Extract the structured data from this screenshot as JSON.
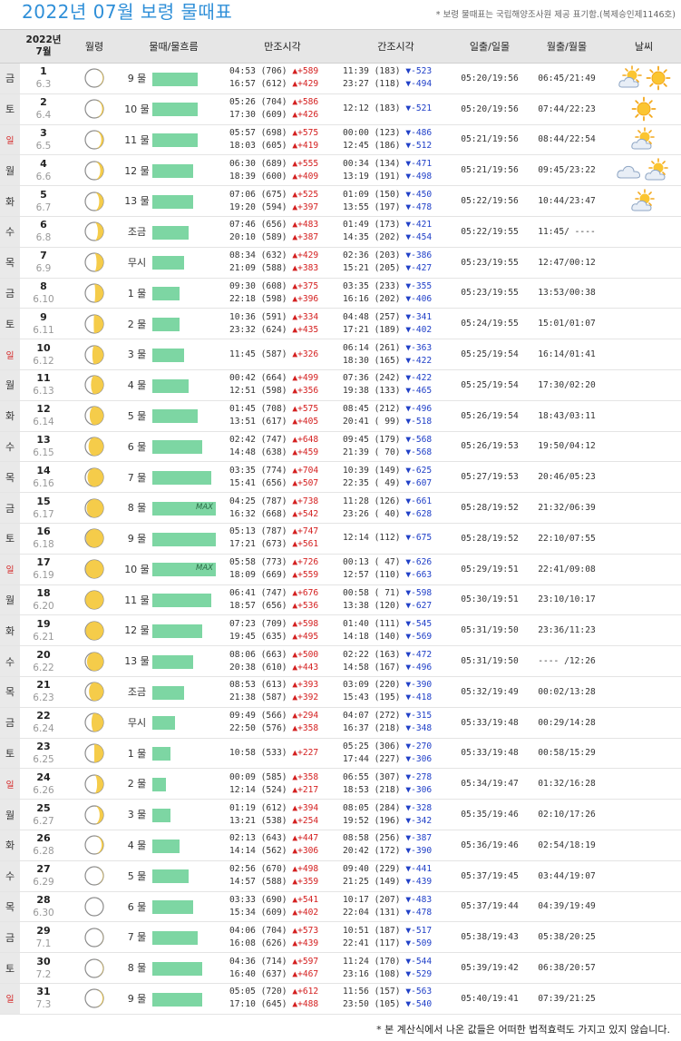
{
  "header": {
    "title": "2022년 07월 보령 물때표",
    "note": "* 보령 물때표는 국립해양조사원 제공 표기함.(복제승인제1146호)"
  },
  "columns": {
    "date_line1": "2022년",
    "date_line2": "7월",
    "moon": "월령",
    "mul": "물때/물흐름",
    "high": "만조시각",
    "low": "간조시각",
    "sun": "일출/일몰",
    "moonrise": "월출/월몰",
    "weather": "날씨"
  },
  "colors": {
    "title": "#2f8fd8",
    "bar": "#7dd6a3",
    "high": "#d42020",
    "low": "#2040c8",
    "sunday": "#d42020"
  },
  "icons": {
    "moon": "moon-phase-icon",
    "sunny": "sun-icon",
    "partly": "sun-cloud-icon",
    "cloudy": "cloud-icon"
  },
  "rows": [
    {
      "dow": "금",
      "day": "1",
      "lunar": "6.3",
      "phase": 0.12,
      "mul": "9 물",
      "flow": 0.71,
      "max": "",
      "high1": "04:53 (706) ▲+589",
      "high2": "16:57 (612) ▲+429",
      "low1": "11:39 (183) ▼-523",
      "low2": "23:27 (118) ▼-494",
      "sun": "05:20/19:56",
      "moon": "06:45/21:49",
      "wx": [
        "sun-cloud",
        "sun"
      ]
    },
    {
      "dow": "토",
      "day": "2",
      "lunar": "6.4",
      "phase": 0.17,
      "mul": "10 물",
      "flow": 0.71,
      "max": "",
      "high1": "05:26 (704) ▲+586",
      "high2": "17:30 (609) ▲+426",
      "low1": "12:12 (183) ▼-521",
      "low2": "",
      "sun": "05:20/19:56",
      "moon": "07:44/22:23",
      "wx": [
        "sun"
      ]
    },
    {
      "dow": "일",
      "day": "3",
      "lunar": "6.5",
      "phase": 0.22,
      "mul": "11 물",
      "flow": 0.71,
      "max": "",
      "high1": "05:57 (698) ▲+575",
      "high2": "18:03 (605) ▲+419",
      "low1": "00:00 (123) ▼-486",
      "low2": "12:45 (186) ▼-512",
      "sun": "05:21/19:56",
      "moon": "08:44/22:54",
      "wx": [
        "sun-cloud"
      ]
    },
    {
      "dow": "월",
      "day": "4",
      "lunar": "6.6",
      "phase": 0.27,
      "mul": "12 물",
      "flow": 0.64,
      "max": "",
      "high1": "06:30 (689) ▲+555",
      "high2": "18:39 (600) ▲+409",
      "low1": "00:34 (134) ▼-471",
      "low2": "13:19 (191) ▼-498",
      "sun": "05:21/19:56",
      "moon": "09:45/23:22",
      "wx": [
        "cloud",
        "sun-cloud"
      ]
    },
    {
      "dow": "화",
      "day": "5",
      "lunar": "6.7",
      "phase": 0.32,
      "mul": "13 물",
      "flow": 0.64,
      "max": "",
      "high1": "07:06 (675) ▲+525",
      "high2": "19:20 (594) ▲+397",
      "low1": "01:09 (150) ▼-450",
      "low2": "13:55 (197) ▼-478",
      "sun": "05:22/19:56",
      "moon": "10:44/23:47",
      "wx": [
        "sun-cloud"
      ]
    },
    {
      "dow": "수",
      "day": "6",
      "lunar": "6.8",
      "phase": 0.37,
      "mul": "조금",
      "flow": 0.57,
      "max": "",
      "high1": "07:46 (656) ▲+483",
      "high2": "20:10 (589) ▲+387",
      "low1": "01:49 (173) ▼-421",
      "low2": "14:35 (202) ▼-454",
      "sun": "05:22/19:55",
      "moon": "11:45/ ----",
      "wx": []
    },
    {
      "dow": "목",
      "day": "7",
      "lunar": "6.9",
      "phase": 0.42,
      "mul": "무시",
      "flow": 0.5,
      "max": "",
      "high1": "08:34 (632) ▲+429",
      "high2": "21:09 (588) ▲+383",
      "low1": "02:36 (203) ▼-386",
      "low2": "15:21 (205) ▼-427",
      "sun": "05:23/19:55",
      "moon": "12:47/00:12",
      "wx": []
    },
    {
      "dow": "금",
      "day": "8",
      "lunar": "6.10",
      "phase": 0.47,
      "mul": "1 물",
      "flow": 0.43,
      "max": "",
      "high1": "09:30 (608) ▲+375",
      "high2": "22:18 (598) ▲+396",
      "low1": "03:35 (233) ▼-355",
      "low2": "16:16 (202) ▼-406",
      "sun": "05:23/19:55",
      "moon": "13:53/00:38",
      "wx": []
    },
    {
      "dow": "토",
      "day": "9",
      "lunar": "6.11",
      "phase": 0.52,
      "mul": "2 물",
      "flow": 0.43,
      "max": "",
      "high1": "10:36 (591) ▲+334",
      "high2": "23:32 (624) ▲+435",
      "low1": "04:48 (257) ▼-341",
      "low2": "17:21 (189) ▼-402",
      "sun": "05:24/19:55",
      "moon": "15:01/01:07",
      "wx": []
    },
    {
      "dow": "일",
      "day": "10",
      "lunar": "6.12",
      "phase": 0.57,
      "mul": "3 물",
      "flow": 0.5,
      "max": "",
      "high1": "11:45 (587) ▲+326",
      "high2": "",
      "low1": "06:14 (261) ▼-363",
      "low2": "18:30 (165) ▼-422",
      "sun": "05:25/19:54",
      "moon": "16:14/01:41",
      "wx": []
    },
    {
      "dow": "월",
      "day": "11",
      "lunar": "6.13",
      "phase": 0.62,
      "mul": "4 물",
      "flow": 0.57,
      "max": "",
      "high1": "00:42 (664) ▲+499",
      "high2": "12:51 (598) ▲+356",
      "low1": "07:36 (242) ▼-422",
      "low2": "19:38 (133) ▼-465",
      "sun": "05:25/19:54",
      "moon": "17:30/02:20",
      "wx": []
    },
    {
      "dow": "화",
      "day": "12",
      "lunar": "6.14",
      "phase": 0.67,
      "mul": "5 물",
      "flow": 0.71,
      "max": "",
      "high1": "01:45 (708) ▲+575",
      "high2": "13:51 (617) ▲+405",
      "low1": "08:45 (212) ▼-496",
      "low2": "20:41 ( 99) ▼-518",
      "sun": "05:26/19:54",
      "moon": "18:43/03:11",
      "wx": []
    },
    {
      "dow": "수",
      "day": "13",
      "lunar": "6.15",
      "phase": 0.72,
      "mul": "6 물",
      "flow": 0.79,
      "max": "",
      "high1": "02:42 (747) ▲+648",
      "high2": "14:48 (638) ▲+459",
      "low1": "09:45 (179) ▼-568",
      "low2": "21:39 ( 70) ▼-568",
      "sun": "05:26/19:53",
      "moon": "19:50/04:12",
      "wx": []
    },
    {
      "dow": "목",
      "day": "14",
      "lunar": "6.16",
      "phase": 0.77,
      "mul": "7 물",
      "flow": 0.93,
      "max": "",
      "high1": "03:35 (774) ▲+704",
      "high2": "15:41 (656) ▲+507",
      "low1": "10:39 (149) ▼-625",
      "low2": "22:35 ( 49) ▼-607",
      "sun": "05:27/19:53",
      "moon": "20:46/05:23",
      "wx": []
    },
    {
      "dow": "금",
      "day": "15",
      "lunar": "6.17",
      "phase": 0.82,
      "mul": "8 물",
      "flow": 1.0,
      "max": "MAX",
      "high1": "04:25 (787) ▲+738",
      "high2": "16:32 (668) ▲+542",
      "low1": "11:28 (126) ▼-661",
      "low2": "23:26 ( 40) ▼-628",
      "sun": "05:28/19:52",
      "moon": "21:32/06:39",
      "wx": []
    },
    {
      "dow": "토",
      "day": "16",
      "lunar": "6.18",
      "phase": 0.87,
      "mul": "9 물",
      "flow": 1.0,
      "max": "",
      "high1": "05:13 (787) ▲+747",
      "high2": "17:21 (673) ▲+561",
      "low1": "12:14 (112) ▼-675",
      "low2": "",
      "sun": "05:28/19:52",
      "moon": "22:10/07:55",
      "wx": []
    },
    {
      "dow": "일",
      "day": "17",
      "lunar": "6.19",
      "phase": 0.9,
      "mul": "10 물",
      "flow": 1.0,
      "max": "MAX",
      "high1": "05:58 (773) ▲+726",
      "high2": "18:09 (669) ▲+559",
      "low1": "00:13 ( 47) ▼-626",
      "low2": "12:57 (110) ▼-663",
      "sun": "05:29/19:51",
      "moon": "22:41/09:08",
      "wx": []
    },
    {
      "dow": "월",
      "day": "18",
      "lunar": "6.20",
      "phase": 0.93,
      "mul": "11 물",
      "flow": 0.93,
      "max": "",
      "high1": "06:41 (747) ▲+676",
      "high2": "18:57 (656) ▲+536",
      "low1": "00:58 ( 71) ▼-598",
      "low2": "13:38 (120) ▼-627",
      "sun": "05:30/19:51",
      "moon": "23:10/10:17",
      "wx": []
    },
    {
      "dow": "화",
      "day": "19",
      "lunar": "6.21",
      "phase": 0.9,
      "mul": "12 물",
      "flow": 0.79,
      "max": "",
      "high1": "07:23 (709) ▲+598",
      "high2": "19:45 (635) ▲+495",
      "low1": "01:40 (111) ▼-545",
      "low2": "14:18 (140) ▼-569",
      "sun": "05:31/19:50",
      "moon": "23:36/11:23",
      "wx": []
    },
    {
      "dow": "수",
      "day": "20",
      "lunar": "6.22",
      "phase": 0.8,
      "mul": "13 물",
      "flow": 0.64,
      "max": "",
      "high1": "08:06 (663) ▲+500",
      "high2": "20:38 (610) ▲+443",
      "low1": "02:22 (163) ▼-472",
      "low2": "14:58 (167) ▼-496",
      "sun": "05:31/19:50",
      "moon": "---- /12:26",
      "wx": []
    },
    {
      "dow": "목",
      "day": "21",
      "lunar": "6.23",
      "phase": 0.7,
      "mul": "조금",
      "flow": 0.5,
      "max": "",
      "high1": "08:53 (613) ▲+393",
      "high2": "21:38 (587) ▲+392",
      "low1": "03:09 (220) ▼-390",
      "low2": "15:43 (195) ▼-418",
      "sun": "05:32/19:49",
      "moon": "00:02/13:28",
      "wx": []
    },
    {
      "dow": "금",
      "day": "22",
      "lunar": "6.24",
      "phase": 0.6,
      "mul": "무시",
      "flow": 0.36,
      "max": "",
      "high1": "09:49 (566) ▲+294",
      "high2": "22:50 (576) ▲+358",
      "low1": "04:07 (272) ▼-315",
      "low2": "16:37 (218) ▼-348",
      "sun": "05:33/19:48",
      "moon": "00:29/14:28",
      "wx": []
    },
    {
      "dow": "토",
      "day": "23",
      "lunar": "6.25",
      "phase": 0.5,
      "mul": "1 물",
      "flow": 0.29,
      "max": "",
      "high1": "10:58 (533) ▲+227",
      "high2": "",
      "low1": "05:25 (306) ▼-270",
      "low2": "17:44 (227) ▼-306",
      "sun": "05:33/19:48",
      "moon": "00:58/15:29",
      "wx": []
    },
    {
      "dow": "일",
      "day": "24",
      "lunar": "6.26",
      "phase": 0.4,
      "mul": "2 물",
      "flow": 0.21,
      "max": "",
      "high1": "00:09 (585) ▲+358",
      "high2": "12:14 (524) ▲+217",
      "low1": "06:55 (307) ▼-278",
      "low2": "18:53 (218) ▼-306",
      "sun": "05:34/19:47",
      "moon": "01:32/16:28",
      "wx": []
    },
    {
      "dow": "월",
      "day": "25",
      "lunar": "6.27",
      "phase": 0.3,
      "mul": "3 물",
      "flow": 0.29,
      "max": "",
      "high1": "01:19 (612) ▲+394",
      "high2": "13:21 (538) ▲+254",
      "low1": "08:05 (284) ▼-328",
      "low2": "19:52 (196) ▼-342",
      "sun": "05:35/19:46",
      "moon": "02:10/17:26",
      "wx": []
    },
    {
      "dow": "화",
      "day": "26",
      "lunar": "6.28",
      "phase": 0.2,
      "mul": "4 물",
      "flow": 0.43,
      "max": "",
      "high1": "02:13 (643) ▲+447",
      "high2": "14:14 (562) ▲+306",
      "low1": "08:58 (256) ▼-387",
      "low2": "20:42 (172) ▼-390",
      "sun": "05:36/19:46",
      "moon": "02:54/18:19",
      "wx": []
    },
    {
      "dow": "수",
      "day": "27",
      "lunar": "6.29",
      "phase": 0.1,
      "mul": "5 물",
      "flow": 0.57,
      "max": "",
      "high1": "02:56 (670) ▲+498",
      "high2": "14:57 (588) ▲+359",
      "low1": "09:40 (229) ▼-441",
      "low2": "21:25 (149) ▼-439",
      "sun": "05:37/19:45",
      "moon": "03:44/19:07",
      "wx": []
    },
    {
      "dow": "목",
      "day": "28",
      "lunar": "6.30",
      "phase": 0.0,
      "mul": "6 물",
      "flow": 0.64,
      "max": "",
      "high1": "03:33 (690) ▲+541",
      "high2": "15:34 (609) ▲+402",
      "low1": "10:17 (207) ▼-483",
      "low2": "22:04 (131) ▼-478",
      "sun": "05:37/19:44",
      "moon": "04:39/19:49",
      "wx": []
    },
    {
      "dow": "금",
      "day": "29",
      "lunar": "7.1",
      "phase": 0.06,
      "mul": "7 물",
      "flow": 0.71,
      "max": "",
      "high1": "04:06 (704) ▲+573",
      "high2": "16:08 (626) ▲+439",
      "low1": "10:51 (187) ▼-517",
      "low2": "22:41 (117) ▼-509",
      "sun": "05:38/19:43",
      "moon": "05:38/20:25",
      "wx": []
    },
    {
      "dow": "토",
      "day": "30",
      "lunar": "7.2",
      "phase": 0.1,
      "mul": "8 물",
      "flow": 0.79,
      "max": "",
      "high1": "04:36 (714) ▲+597",
      "high2": "16:40 (637) ▲+467",
      "low1": "11:24 (170) ▼-544",
      "low2": "23:16 (108) ▼-529",
      "sun": "05:39/19:42",
      "moon": "06:38/20:57",
      "wx": []
    },
    {
      "dow": "일",
      "day": "31",
      "lunar": "7.3",
      "phase": 0.14,
      "mul": "9 물",
      "flow": 0.79,
      "max": "",
      "high1": "05:05 (720) ▲+612",
      "high2": "17:10 (645) ▲+488",
      "low1": "11:56 (157) ▼-563",
      "low2": "23:50 (105) ▼-540",
      "sun": "05:40/19:41",
      "moon": "07:39/21:25",
      "wx": []
    }
  ],
  "footer": "* 본 계산식에서 나온 값들은 어떠한 법적효력도 가지고 있지 않습니다."
}
